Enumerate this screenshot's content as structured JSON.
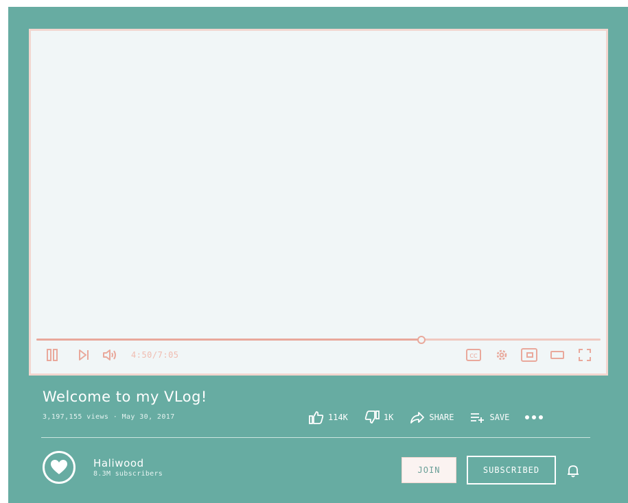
{
  "video": {
    "progress_fraction": 0.682,
    "time_display": "4:50/7:05"
  },
  "info": {
    "title": "Welcome to my VLog!",
    "meta": "3,197,155 views · May 30, 2017"
  },
  "actions": {
    "likes": "114K",
    "dislikes": "1K",
    "share": "SHARE",
    "save": "SAVE"
  },
  "channel": {
    "name": "Haliwood",
    "subscribers": "8.3M subscribers"
  },
  "buttons": {
    "join": "JOIN",
    "subscribed": "SUBSCRIBED"
  },
  "colors": {
    "background": "#67aca2",
    "player": "#f1f6f7",
    "accent": "#e9a89b",
    "border": "#f2d6cf"
  }
}
